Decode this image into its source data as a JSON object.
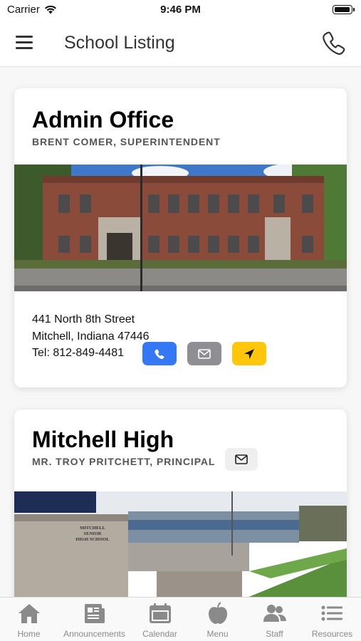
{
  "status_bar": {
    "carrier": "Carrier",
    "time": "9:46 PM"
  },
  "nav": {
    "title": "School Listing"
  },
  "schools": [
    {
      "name": "Admin Office",
      "subtitle": "BRENT COMER, SUPERINTENDENT",
      "address_line1": "441 North 8th Street",
      "address_line2": "Mitchell, Indiana 47446",
      "phone": "Tel: 812-849-4481"
    },
    {
      "name": "Mitchell High",
      "subtitle": "MR. TROY PRITCHETT, PRINCIPAL",
      "sign_text": [
        "MITCHELL",
        "SENIOR",
        "HIGH SCHOOL"
      ]
    }
  ],
  "tabs": [
    {
      "label": "Home",
      "icon": "home-icon"
    },
    {
      "label": "Announcements",
      "icon": "newspaper-icon"
    },
    {
      "label": "Calendar",
      "icon": "calendar-icon"
    },
    {
      "label": "Menu",
      "icon": "apple-icon"
    },
    {
      "label": "Staff",
      "icon": "people-icon"
    },
    {
      "label": "Resources",
      "icon": "list-icon"
    }
  ],
  "colors": {
    "call": "#3478f6",
    "email": "#8e8e93",
    "directions": "#ffc60a",
    "tab_icon": "#8a8a8a"
  }
}
